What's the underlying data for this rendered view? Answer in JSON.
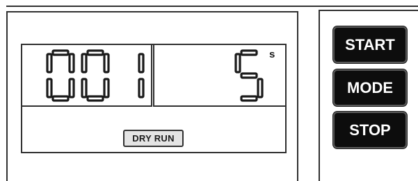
{
  "display": {
    "counter_value": "001",
    "timer_value": "5",
    "timer_unit": "s",
    "mode_indicator": "DRY RUN"
  },
  "controls": {
    "start_label": "START",
    "mode_label": "MODE",
    "stop_label": "STOP"
  },
  "colors": {
    "button_background": "#0d0d0d",
    "button_text": "#ffffff",
    "outline": "#303030",
    "indicator_background": "#e4e4e4"
  }
}
